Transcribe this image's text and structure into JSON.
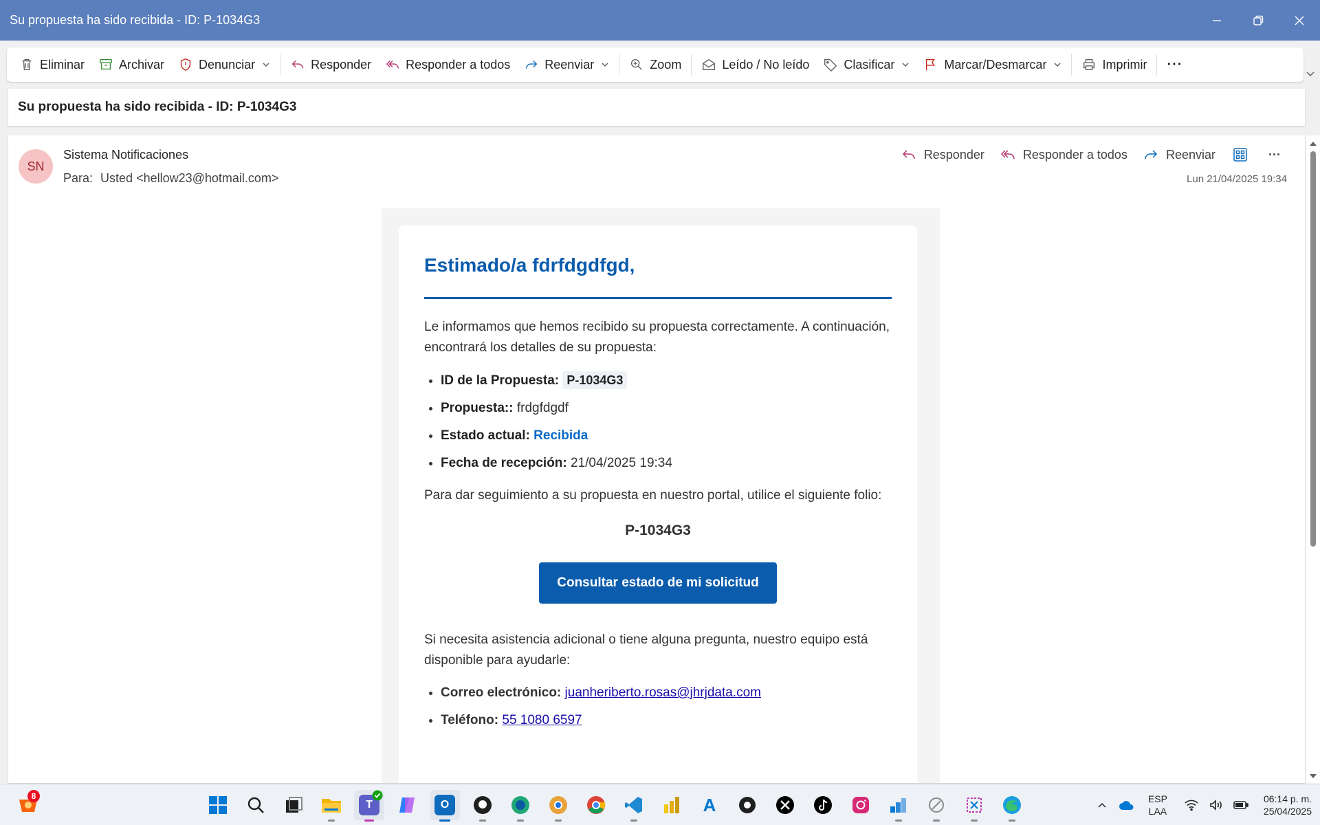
{
  "window": {
    "title": "Su propuesta ha sido recibida - ID: P-1034G3"
  },
  "toolbar": {
    "delete": "Eliminar",
    "archive": "Archivar",
    "report": "Denunciar",
    "reply": "Responder",
    "reply_all": "Responder a todos",
    "forward": "Reenviar",
    "zoom": "Zoom",
    "read_unread": "Leído / No leído",
    "categorize": "Clasificar",
    "flag": "Marcar/Desmarcar",
    "print": "Imprimir",
    "more": "···"
  },
  "message": {
    "subject": "Su propuesta ha sido recibida - ID: P-1034G3",
    "avatar_initials": "SN",
    "sender": "Sistema Notificaciones",
    "to_label": "Para:",
    "to_value": "Usted <hellow23@hotmail.com>",
    "date": "Lun 21/04/2025 19:34",
    "actions": {
      "reply": "Responder",
      "reply_all": "Responder a todos",
      "forward": "Reenviar",
      "more": "···"
    }
  },
  "email_body": {
    "greeting": "Estimado/a fdrfdgdfgd,",
    "intro": "Le informamos que hemos recibido su propuesta correctamente. A continuación, encontrará los detalles de su propuesta:",
    "details": {
      "id_label": "ID de la Propuesta:",
      "id_value": "P-1034G3",
      "proposal_label": "Propuesta::",
      "proposal_value": "frdgfdgdf",
      "status_label": "Estado actual:",
      "status_value": "Recibida",
      "date_label": "Fecha de recepción:",
      "date_value": "21/04/2025 19:34"
    },
    "followup": "Para dar seguimiento a su propuesta en nuestro portal, utilice el siguiente folio:",
    "folio": "P-1034G3",
    "cta_button": "Consultar estado de mi solicitud",
    "assist": "Si necesita asistencia adicional o tiene alguna pregunta, nuestro equipo está disponible para ayudarle:",
    "contact": {
      "email_label": "Correo electrónico:",
      "email_value": "juanheriberto.rosas@jhrjdata.com",
      "phone_label": "Teléfono:",
      "phone_value": "55 1080 6597"
    }
  },
  "taskbar": {
    "notification_count": "8",
    "apps": [
      "start-icon",
      "search-icon",
      "task-view-icon",
      "file-explorer-icon",
      "teams-icon",
      "copilot-icon",
      "outlook-icon",
      "github-icon",
      "edge-beta-icon",
      "chrome-canary-icon",
      "chrome-icon",
      "vscode-icon",
      "power-bi-icon",
      "azure-icon",
      "app-icon",
      "x-icon",
      "tiktok-icon",
      "instagram-icon",
      "app-icon",
      "app-icon",
      "snipping-tool-icon",
      "edge-icon"
    ],
    "language_top": "ESP",
    "language_bottom": "LAA",
    "time": "06:14 p. m.",
    "date": "25/04/2025"
  },
  "colors": {
    "titlebar": "#5b7fbd",
    "accent_blue": "#0b5cad",
    "status_blue": "#0b6ac9",
    "avatar_bg": "#f6c4c4"
  }
}
